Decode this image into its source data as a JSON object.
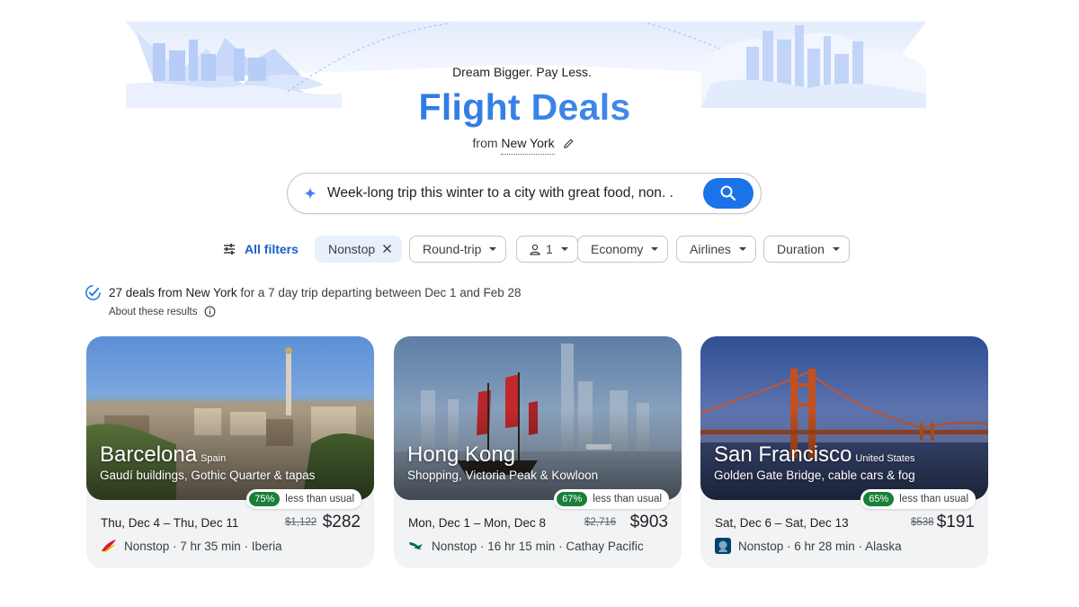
{
  "header": {
    "tagline": "Dream Bigger. Pay Less.",
    "title": "Flight Deals",
    "from_prefix": "from",
    "from_city": "New York"
  },
  "search": {
    "query": "Week-long trip this winter to a city with great food, non. ."
  },
  "filters": {
    "all_filters": "All filters",
    "chips": [
      {
        "label": "Nonstop",
        "active": true
      },
      {
        "label": "Round-trip"
      },
      {
        "label": "1"
      },
      {
        "label": "Economy"
      },
      {
        "label": "Airlines"
      },
      {
        "label": "Duration"
      }
    ]
  },
  "summary": {
    "count_text": "27 deals from New York",
    "rest_text": "for a 7 day trip departing between Dec 1 and Feb 28",
    "about": "About these results"
  },
  "cards": [
    {
      "city": "Barcelona",
      "country": "Spain",
      "subtitle": "Gaudí buildings, Gothic Quarter & tapas",
      "badge_pct": "75%",
      "badge_text": "less than usual",
      "dates": "Thu, Dec 4 – Thu, Dec 11",
      "old_price": "$1,122",
      "price": "$282",
      "details": "Nonstop · 7 hr 35 min · Iberia",
      "airline_logo": "iberia-logo"
    },
    {
      "city": "Hong Kong",
      "country": "",
      "subtitle": "Shopping, Victoria Peak & Kowloon",
      "badge_pct": "67%",
      "badge_text": "less than usual",
      "dates": "Mon, Dec 1 – Mon, Dec 8",
      "old_price": "$2,716",
      "price": "$903",
      "details": "Nonstop · 16 hr 15 min · Cathay Pacific",
      "airline_logo": "cathay-pacific-logo"
    },
    {
      "city": "San Francisco",
      "country": "United States",
      "subtitle": "Golden Gate Bridge, cable cars & fog",
      "badge_pct": "65%",
      "badge_text": "less than usual",
      "dates": "Sat, Dec 6 – Sat, Dec 13",
      "old_price": "$538",
      "price": "$191",
      "details": "Nonstop · 6 hr 28 min · Alaska",
      "airline_logo": "alaska-logo"
    }
  ],
  "colors": {
    "accent_blue": "#1a73e8",
    "badge_green": "#188038",
    "title_gradient": [
      "#3b6fe0",
      "#4a90e8"
    ]
  }
}
